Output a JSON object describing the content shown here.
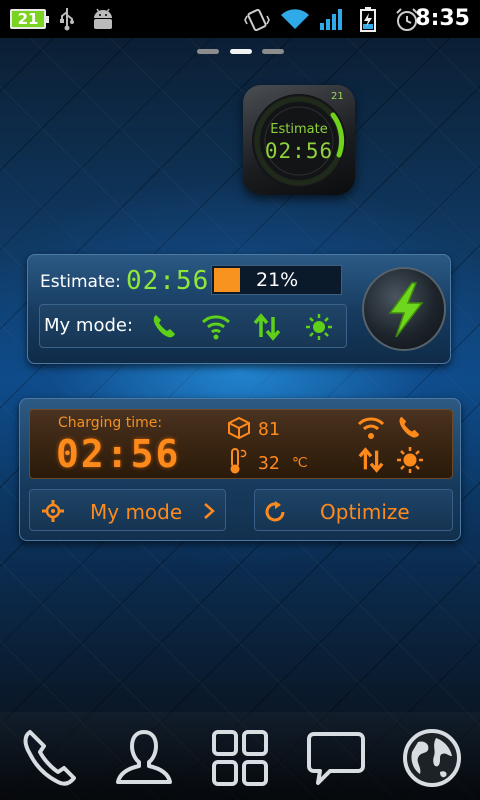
{
  "status_bar": {
    "battery_level": "21",
    "time": "8:35",
    "icons": [
      "usb-icon",
      "android-debug-icon",
      "vibrate-icon",
      "wifi-icon",
      "signal-icon",
      "battery-charging-icon",
      "alarm-icon"
    ]
  },
  "page_indicator": {
    "count": 3,
    "active_index": 1
  },
  "clock_widget": {
    "label": "Estimate",
    "time": "02:56",
    "dial_number": "21"
  },
  "estimate_widget": {
    "estimate_label": "Estimate:",
    "estimate_time": "02:56",
    "battery_percent_label": "21%",
    "battery_fraction": 0.21,
    "mode_label": "My mode:",
    "mode_icons": [
      "phone-icon",
      "wifi-icon",
      "data-sync-icon",
      "brightness-icon"
    ],
    "accent_color": "#8ee83a"
  },
  "charging_widget": {
    "charging_label": "Charging time:",
    "charging_time": "02:56",
    "battery_value": "81",
    "temperature_value": "32",
    "temperature_unit": "℃",
    "my_mode_button": "My mode",
    "optimize_button": "Optimize",
    "accent_color": "#ff8a1c"
  },
  "dock": {
    "items": [
      "phone-icon",
      "contacts-icon",
      "app-drawer-icon",
      "messaging-icon",
      "browser-icon"
    ]
  }
}
